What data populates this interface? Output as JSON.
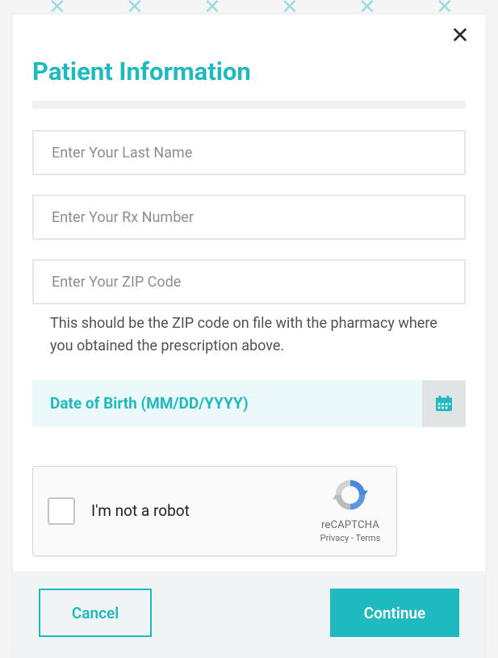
{
  "modal": {
    "title": "Patient Information",
    "fields": {
      "last_name": {
        "value": "",
        "placeholder": "Enter Your Last Name"
      },
      "rx_number": {
        "value": "",
        "placeholder": "Enter Your Rx Number"
      },
      "zip": {
        "value": "",
        "placeholder": "Enter Your ZIP Code"
      },
      "zip_hint": "This should be the ZIP code on file with the pharmacy where you obtained the prescription above.",
      "dob": {
        "value": "",
        "placeholder": "Date of Birth (MM/DD/YYYY)"
      }
    },
    "captcha": {
      "label": "I'm not a robot",
      "brand": "reCAPTCHA",
      "links": "Privacy - Terms"
    },
    "buttons": {
      "cancel": "Cancel",
      "continue": "Continue"
    }
  },
  "colors": {
    "accent": "#1fb9c0"
  }
}
